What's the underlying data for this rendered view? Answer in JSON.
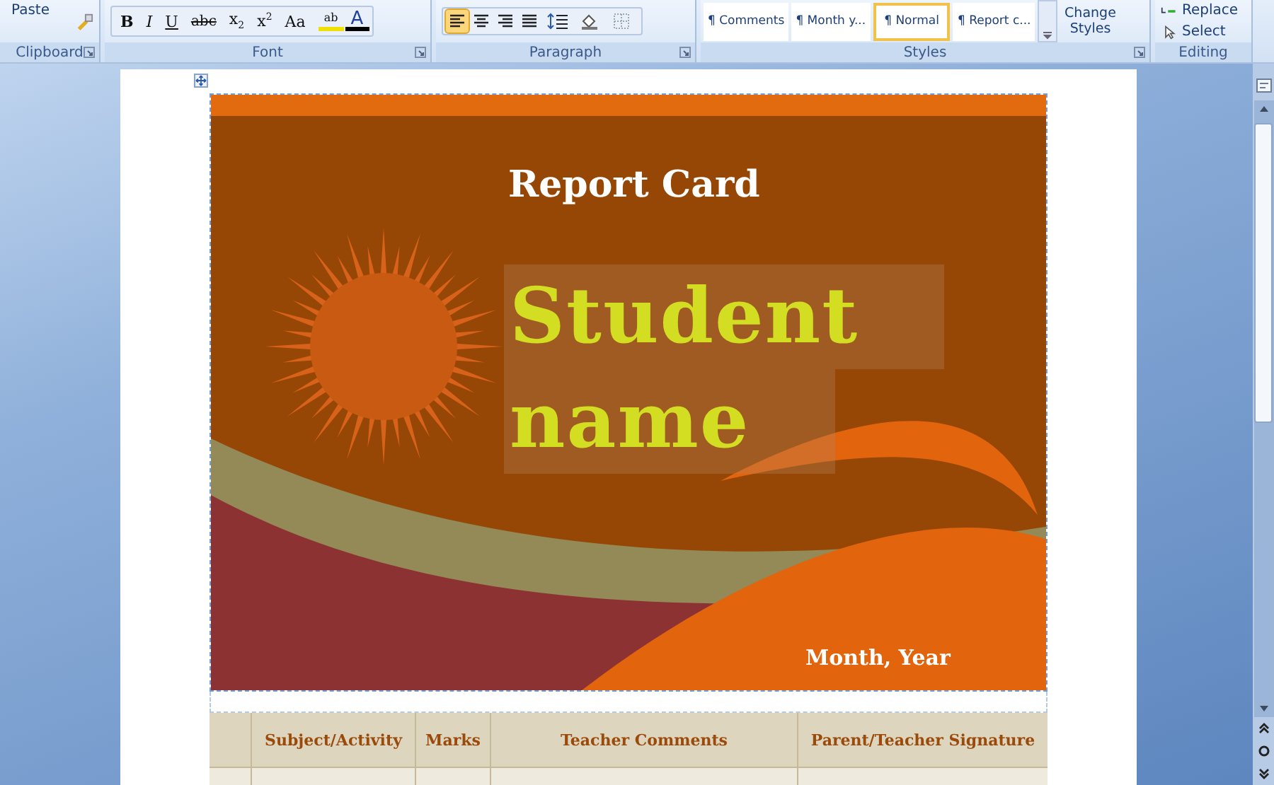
{
  "ribbon": {
    "clipboard": {
      "label": "Clipboard",
      "paste": "Paste"
    },
    "font": {
      "label": "Font",
      "buttons": [
        {
          "kind": "bold",
          "text": "B"
        },
        {
          "kind": "italic",
          "text": "I"
        },
        {
          "kind": "underline",
          "text": "U"
        },
        {
          "kind": "strike",
          "text": "abc"
        },
        {
          "kind": "sub",
          "text": "x",
          "mark": "2"
        },
        {
          "kind": "sup",
          "text": "x",
          "mark": "2"
        },
        {
          "kind": "case",
          "text": "Aa"
        }
      ],
      "highlight": "ab",
      "font_color": "A"
    },
    "paragraph": {
      "label": "Paragraph",
      "align": [
        {
          "kind": "left",
          "selected": true
        },
        {
          "kind": "center",
          "selected": false
        },
        {
          "kind": "right",
          "selected": false
        },
        {
          "kind": "justify",
          "selected": false
        }
      ]
    },
    "styles": {
      "label": "Styles",
      "items": [
        {
          "label": "¶ Comments",
          "selected": false
        },
        {
          "label": "¶ Month y...",
          "selected": false
        },
        {
          "label": "¶ Normal",
          "selected": true
        },
        {
          "label": "¶ Report c...",
          "selected": false
        }
      ],
      "change_styles": "Change Styles"
    },
    "editing": {
      "label": "Editing",
      "replace": "Replace",
      "select": "Select"
    }
  },
  "document": {
    "title": "Report Card",
    "student_name": "Student name",
    "date": "Month, Year",
    "table": {
      "columns": [
        "Subject/Activity",
        "Marks",
        "Teacher Comments",
        "Parent/Teacher Signature"
      ]
    }
  }
}
